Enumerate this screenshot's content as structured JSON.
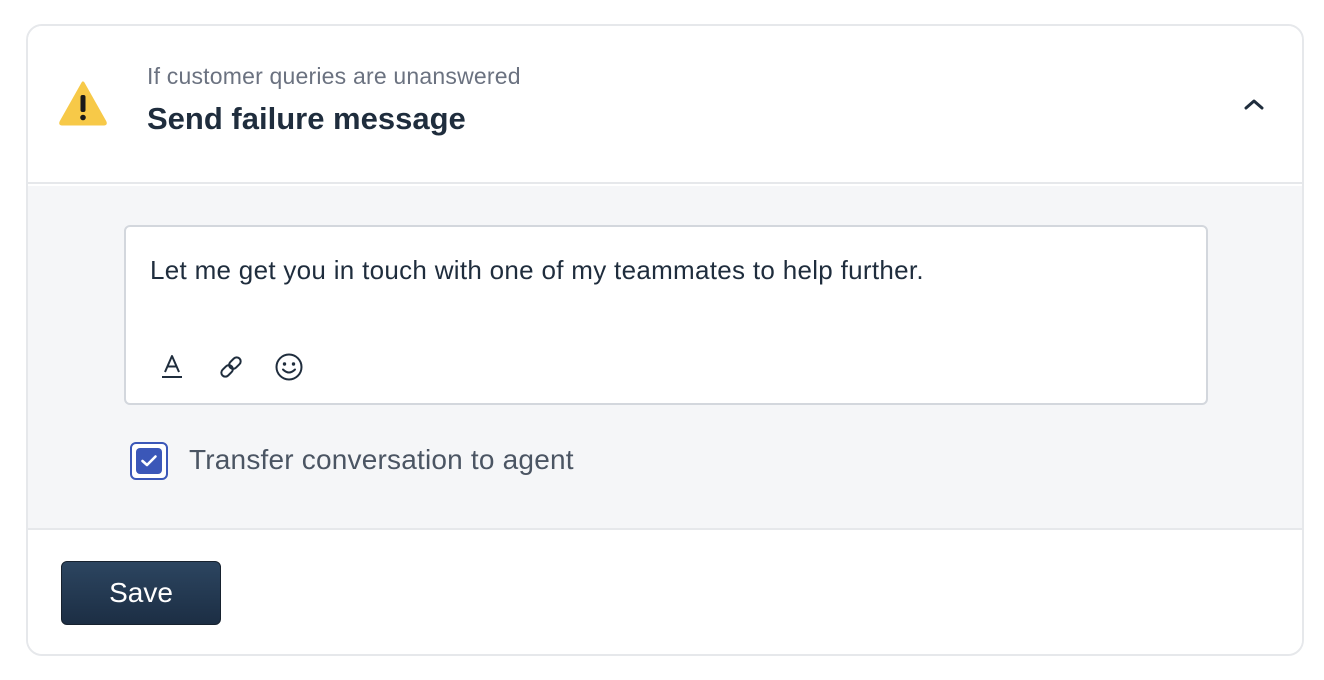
{
  "rule": {
    "subtitle": "If customer queries are unanswered",
    "title": "Send failure message",
    "status_icon": "warning-icon",
    "collapse_icon": "chevron-up-icon",
    "warning_color": "#F7C948"
  },
  "editor": {
    "message": "Let me get you in touch with one of my teammates to help further.",
    "toolbar": [
      {
        "icon": "text-format-icon"
      },
      {
        "icon": "link-icon"
      },
      {
        "icon": "emoji-icon"
      }
    ]
  },
  "transfer": {
    "label": "Transfer conversation to agent",
    "checked": true,
    "accent_color": "#3B57B8"
  },
  "footer": {
    "save_label": "Save",
    "button_color": "#243B53"
  }
}
